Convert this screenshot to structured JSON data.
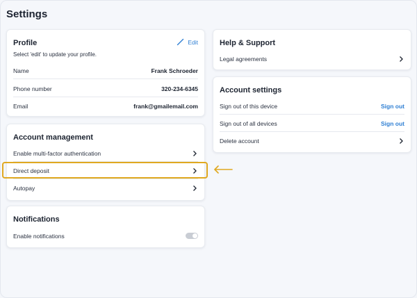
{
  "page": {
    "title": "Settings"
  },
  "profile": {
    "title": "Profile",
    "edit_label": "Edit",
    "subtitle": "Select 'edit' to update your profile.",
    "rows": [
      {
        "label": "Name",
        "value": "Frank Schroeder"
      },
      {
        "label": "Phone number",
        "value": "320-234-6345"
      },
      {
        "label": "Email",
        "value": "frank@gmailemail.com"
      }
    ]
  },
  "account_management": {
    "title": "Account management",
    "items": [
      {
        "label": "Enable multi-factor authentication"
      },
      {
        "label": "Direct deposit"
      },
      {
        "label": "Autopay"
      }
    ]
  },
  "notifications": {
    "title": "Notifications",
    "enable_label": "Enable notifications",
    "enabled": false
  },
  "help_support": {
    "title": "Help & Support",
    "items": [
      {
        "label": "Legal agreements"
      }
    ]
  },
  "account_settings": {
    "title": "Account settings",
    "items": [
      {
        "label": "Sign out of this device",
        "action": "Sign out"
      },
      {
        "label": "Sign out of all devices",
        "action": "Sign out"
      },
      {
        "label": "Delete account"
      }
    ]
  },
  "colors": {
    "accent": "#2f7fd3",
    "highlight": "#e0a820",
    "background": "#f4f6fa"
  },
  "icons": {
    "edit": "pencil-icon",
    "chevron": "chevron-right-icon",
    "pointer": "arrow-left-icon"
  }
}
